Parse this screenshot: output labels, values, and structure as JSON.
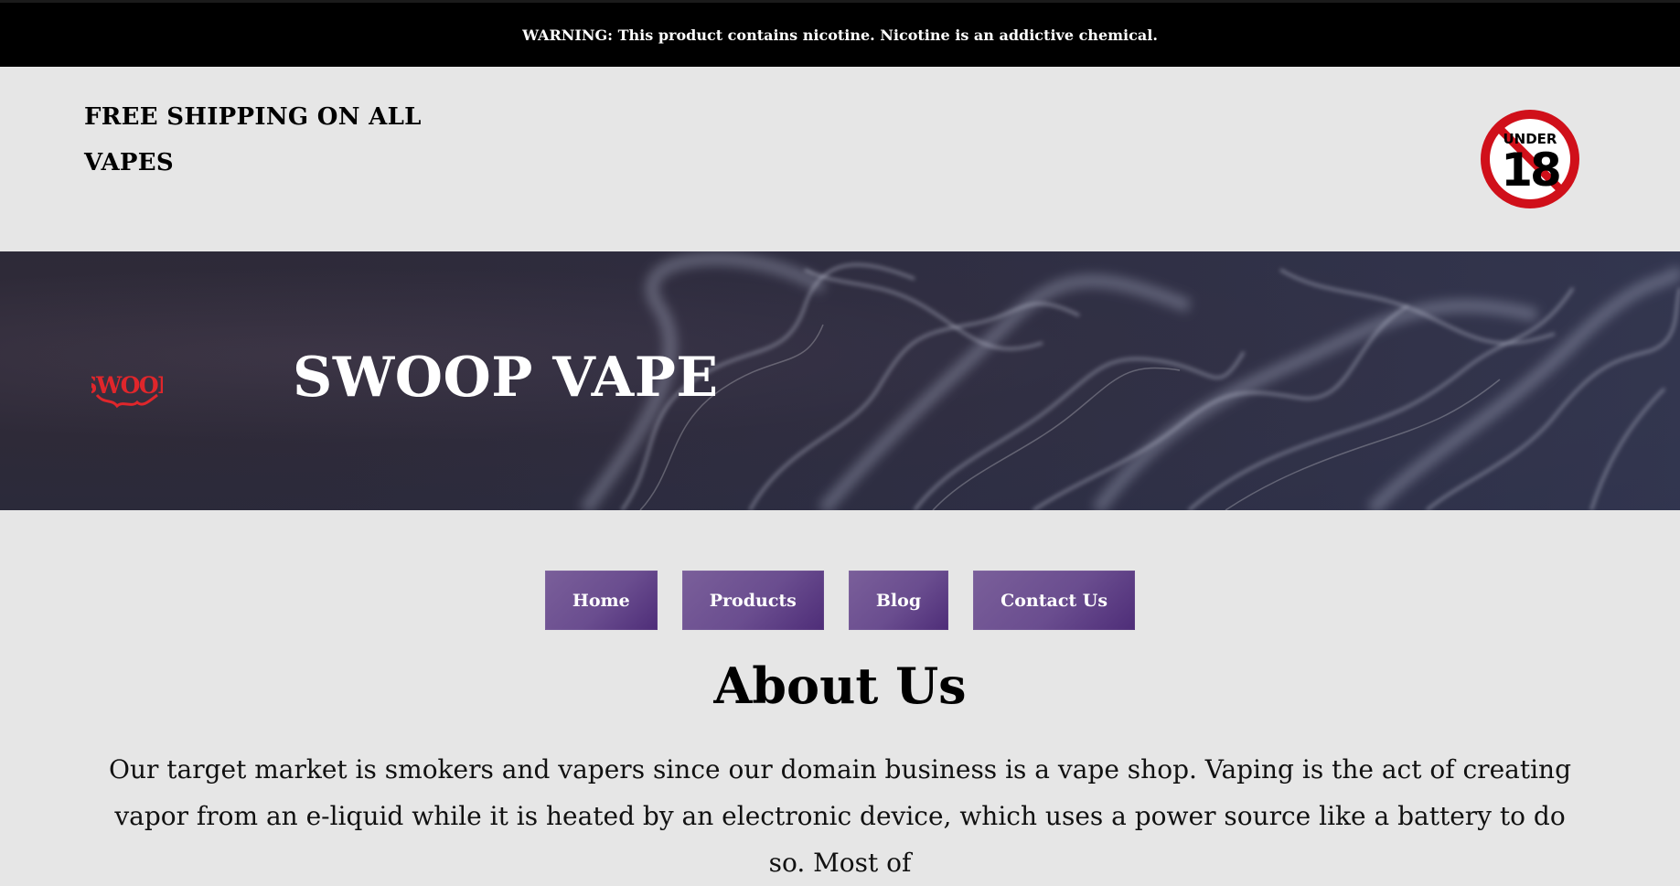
{
  "warning": {
    "text": "WARNING: This product contains nicotine. Nicotine is an addictive chemical."
  },
  "header": {
    "shipping_text": "FREE SHIPPING ON ALL VAPES",
    "age_badge": {
      "icon": "under-18-prohibited-icon",
      "top_text": "UNDER",
      "number": "18",
      "ring_color": "#d0101a"
    }
  },
  "hero": {
    "logo_text": "SWOOP",
    "logo_color": "#e0262b",
    "title": "SWOOP VAPE"
  },
  "nav": {
    "items": [
      {
        "label": "Home"
      },
      {
        "label": "Products"
      },
      {
        "label": "Blog"
      },
      {
        "label": "Contact Us"
      }
    ],
    "button_color": "#6a4d8f"
  },
  "about": {
    "title": "About Us",
    "body": "Our target market is smokers and vapers since our domain business is a vape shop. Vaping is the act of creating vapor from an e-liquid while it is heated by an electronic device, which uses a power source like a battery to do so. Most of"
  }
}
